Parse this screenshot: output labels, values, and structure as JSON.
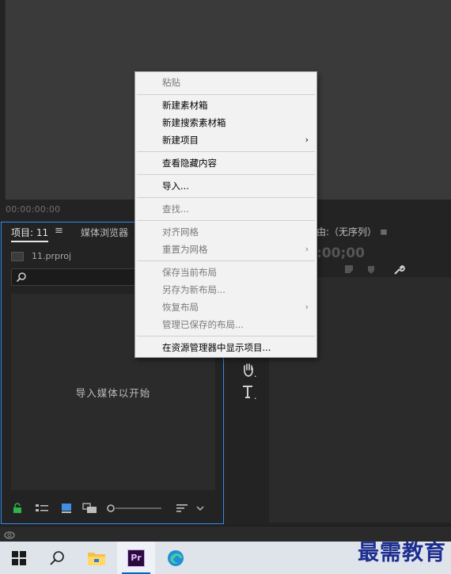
{
  "monitor": {
    "timecode": "00:00:00:00"
  },
  "project_panel": {
    "tab_project": "项目: 11",
    "tab_media_browser": "媒体浏览器",
    "file_name": "11.prproj",
    "empty_hint": "导入媒体以开始"
  },
  "timeline": {
    "title": "由:（无序列）",
    "timecode": ":00;00"
  },
  "context_menu": {
    "items": [
      {
        "label": "粘贴",
        "enabled": false
      },
      {
        "label": "新建素材箱",
        "enabled": true
      },
      {
        "label": "新建搜索素材箱",
        "enabled": true
      },
      {
        "label": "新建项目",
        "enabled": true,
        "submenu": true
      },
      {
        "label": "查看隐藏内容",
        "enabled": true
      },
      {
        "label": "导入...",
        "enabled": true
      },
      {
        "label": "查找...",
        "enabled": false
      },
      {
        "label": "对齐网格",
        "enabled": false
      },
      {
        "label": "重置为网格",
        "enabled": false,
        "submenu": true
      },
      {
        "label": "保存当前布局",
        "enabled": false
      },
      {
        "label": "另存为新布局...",
        "enabled": false
      },
      {
        "label": "恢复布局",
        "enabled": false,
        "submenu": true
      },
      {
        "label": "管理已保存的布局...",
        "enabled": false
      },
      {
        "label": "在资源管理器中显示项目...",
        "enabled": true
      }
    ],
    "submenu_glyph": "›"
  },
  "taskbar": {
    "premiere_label": "Pr"
  },
  "watermark": "最需教育",
  "colors": {
    "panel_focus": "#2d8ceb",
    "menu_bg": "#f2f2f2",
    "taskbar_accent": "#0067c0"
  }
}
